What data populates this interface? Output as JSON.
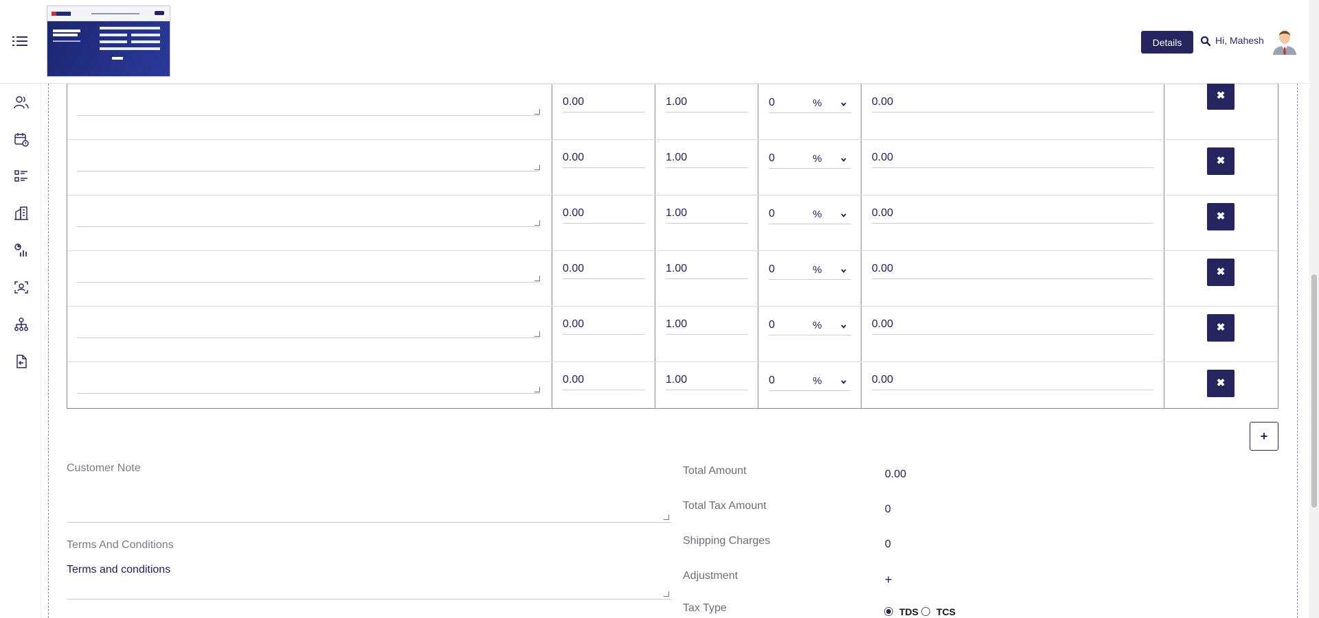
{
  "header": {
    "details_label": "Details",
    "greeting": "Hi, Mahesh",
    "icons": {
      "menu": "menu-icon",
      "search": "search-icon",
      "avatar": "user-avatar"
    }
  },
  "sidebar": {
    "items": [
      {
        "name": "users-icon"
      },
      {
        "name": "calendar-clock-icon"
      },
      {
        "name": "task-list-icon"
      },
      {
        "name": "building-icon"
      },
      {
        "name": "analytics-icon"
      },
      {
        "name": "face-scan-icon"
      },
      {
        "name": "org-chart-icon"
      },
      {
        "name": "document-import-icon"
      }
    ]
  },
  "items": [
    {
      "description": "",
      "rate": "0.00",
      "quantity": "1.00",
      "discount": "0",
      "discount_unit": "%",
      "amount": "0.00"
    },
    {
      "description": "",
      "rate": "0.00",
      "quantity": "1.00",
      "discount": "0",
      "discount_unit": "%",
      "amount": "0.00"
    },
    {
      "description": "",
      "rate": "0.00",
      "quantity": "1.00",
      "discount": "0",
      "discount_unit": "%",
      "amount": "0.00"
    },
    {
      "description": "",
      "rate": "0.00",
      "quantity": "1.00",
      "discount": "0",
      "discount_unit": "%",
      "amount": "0.00"
    },
    {
      "description": "",
      "rate": "0.00",
      "quantity": "1.00",
      "discount": "0",
      "discount_unit": "%",
      "amount": "0.00"
    },
    {
      "description": "",
      "rate": "0.00",
      "quantity": "1.00",
      "discount": "0",
      "discount_unit": "%",
      "amount": "0.00"
    }
  ],
  "actions": {
    "delete_symbol": "✖",
    "add_symbol": "+"
  },
  "notes": {
    "customer_note_label": "Customer Note",
    "terms_label": "Terms And Conditions",
    "terms_value": "Terms and conditions"
  },
  "summary": {
    "total_amount_label": "Total Amount",
    "total_amount_value": "0.00",
    "total_tax_label": "Total Tax Amount",
    "total_tax_value": "0",
    "shipping_label": "Shipping Charges",
    "shipping_value": "0",
    "adjustment_label": "Adjustment",
    "adjustment_value": "+",
    "tax_type_label": "Tax Type",
    "tax_options": [
      "TDS",
      "TCS"
    ],
    "tax_selected": "TDS"
  }
}
